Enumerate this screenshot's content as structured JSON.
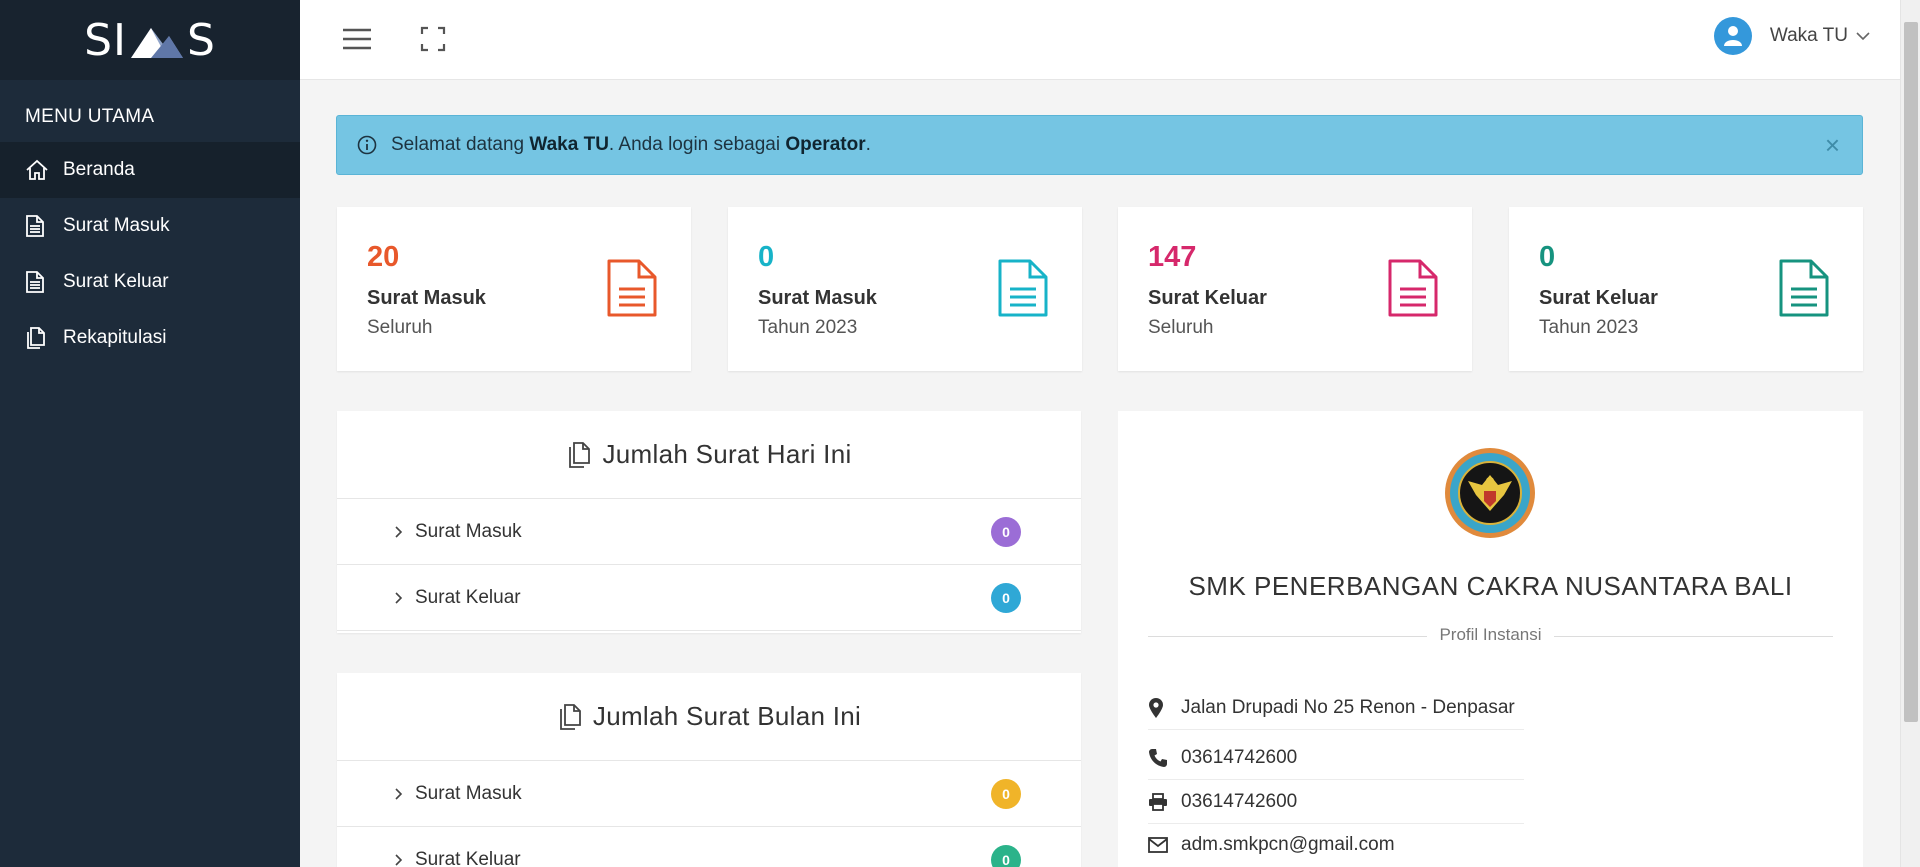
{
  "brand": {
    "left": "SI",
    "right": "S"
  },
  "sidebar": {
    "header": "MENU UTAMA",
    "items": [
      {
        "label": "Beranda",
        "icon": "home-icon"
      },
      {
        "label": "Surat Masuk",
        "icon": "document-icon"
      },
      {
        "label": "Surat Keluar",
        "icon": "document-icon"
      },
      {
        "label": "Rekapitulasi",
        "icon": "copy-icon"
      }
    ]
  },
  "topbar": {
    "user_name": "Waka TU"
  },
  "alert": {
    "prefix": "Selamat datang ",
    "user": "Waka TU",
    "middle": ". Anda login sebagai ",
    "role": "Operator",
    "suffix": ".",
    "close": "×"
  },
  "stats": [
    {
      "value": "20",
      "label": "Surat Masuk",
      "sub": "Seluruh",
      "color": "#e8582b"
    },
    {
      "value": "0",
      "label": "Surat Masuk",
      "sub": "Tahun 2023",
      "color": "#17b3c8"
    },
    {
      "value": "147",
      "label": "Surat Keluar",
      "sub": "Seluruh",
      "color": "#d6286b"
    },
    {
      "value": "0",
      "label": "Surat Keluar",
      "sub": "Tahun 2023",
      "color": "#16937f"
    }
  ],
  "today": {
    "title": "Jumlah Surat Hari Ini",
    "rows": [
      {
        "label": "Surat Masuk",
        "count": "0",
        "color": "#9b6dd6"
      },
      {
        "label": "Surat Keluar",
        "count": "0",
        "color": "#2fa8d6"
      }
    ]
  },
  "month": {
    "title": "Jumlah Surat Bulan Ini",
    "rows": [
      {
        "label": "Surat Masuk",
        "count": "0",
        "color": "#f0b429"
      },
      {
        "label": "Surat Keluar",
        "count": "0",
        "color": "#2bb38a"
      }
    ]
  },
  "profile": {
    "school_name": "SMK PENERBANGAN CAKRA NUSANTARA BALI",
    "section_label": "Profil Instansi",
    "address": "Jalan Drupadi No 25 Renon - Denpasar",
    "phone": "03614742600",
    "fax": "03614742600",
    "email": "adm.smkpcn@gmail.com"
  }
}
